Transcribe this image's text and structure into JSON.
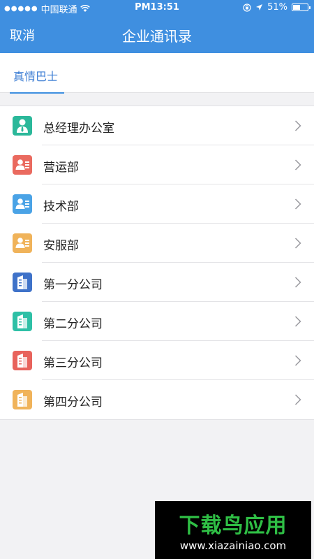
{
  "status_bar": {
    "carrier": "中国联通",
    "time": "PM13:51",
    "battery": "51%",
    "battery_level": 0.51
  },
  "navbar": {
    "cancel_label": "取消",
    "title": "企业通讯录"
  },
  "tabs": [
    {
      "label": "真情巴士",
      "selected": true
    }
  ],
  "departments": [
    {
      "label": "总经理办公室",
      "icon": "manager-icon",
      "color": "#2bb89a"
    },
    {
      "label": "营运部",
      "icon": "person-card-icon",
      "color": "#ea6a5f"
    },
    {
      "label": "技术部",
      "icon": "person-card-icon",
      "color": "#4aa3e6"
    },
    {
      "label": "安服部",
      "icon": "person-card-icon",
      "color": "#f0b35a"
    },
    {
      "label": "第一分公司",
      "icon": "building-icon",
      "color": "#3f72c9"
    },
    {
      "label": "第二分公司",
      "icon": "building-icon",
      "color": "#2ec0a6"
    },
    {
      "label": "第三分公司",
      "icon": "building-icon",
      "color": "#e8635c"
    },
    {
      "label": "第四分公司",
      "icon": "building-icon",
      "color": "#f0b35a"
    }
  ],
  "watermark": {
    "brand": "下载鸟应用",
    "url": "www.xiazainiao.com"
  }
}
